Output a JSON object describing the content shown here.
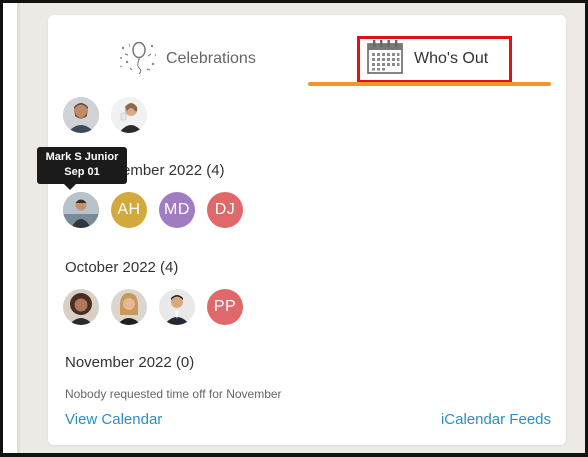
{
  "tabs": {
    "celebrations_label": "Celebrations",
    "whos_out_label": "Who's Out",
    "active": "Who's Out"
  },
  "colors": {
    "accent_underline": "#f0962a",
    "highlight_box": "#e0101a",
    "link": "#2a8fc7"
  },
  "today": {
    "avatars": [
      {
        "name": "",
        "icon": "man-bearded-photo"
      },
      {
        "name": "",
        "icon": "woman-drinking-photo"
      }
    ]
  },
  "tooltip": {
    "name": "Mark S Junior",
    "date": "Sep 01"
  },
  "sections": [
    {
      "heading_visible": "ember 2022 (4)",
      "avatars": [
        {
          "initials": "",
          "color": "#8a9aa8",
          "icon": "man-photo"
        },
        {
          "initials": "AH",
          "color": "#d1a93d"
        },
        {
          "initials": "MD",
          "color": "#a07cc0"
        },
        {
          "initials": "DJ",
          "color": "#e0686b"
        }
      ]
    },
    {
      "heading": "October 2022 (4)",
      "avatars": [
        {
          "initials": "",
          "color": "#6b4a3a",
          "icon": "woman-curly-hair-photo"
        },
        {
          "initials": "",
          "color": "#b08a5f",
          "icon": "woman-blonde-photo"
        },
        {
          "initials": "",
          "color": "#3a3a3a",
          "icon": "man-suit-photo"
        },
        {
          "initials": "PP",
          "color": "#e0686b"
        }
      ]
    },
    {
      "heading": "November 2022 (0)",
      "empty_note": "Nobody requested time off for November"
    }
  ],
  "footer": {
    "view_calendar": "View Calendar",
    "icalendar_feeds": "iCalendar Feeds"
  }
}
